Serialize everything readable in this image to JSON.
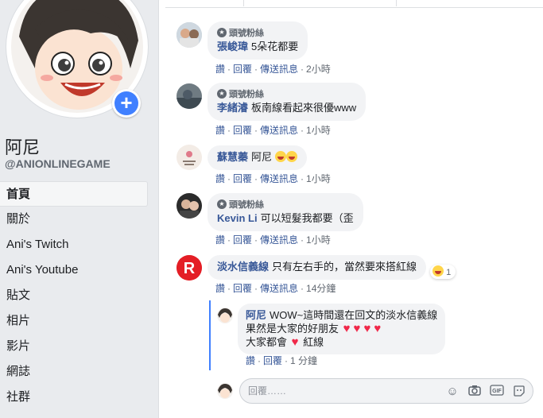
{
  "page": {
    "name": "阿尼",
    "handle": "@ANIONLINEGAME"
  },
  "nav": [
    {
      "label": "首頁"
    },
    {
      "label": "關於"
    },
    {
      "label": "Ani's Twitch"
    },
    {
      "label": "Ani's Youtube"
    },
    {
      "label": "貼文"
    },
    {
      "label": "相片"
    },
    {
      "label": "影片"
    },
    {
      "label": "網誌"
    },
    {
      "label": "社群"
    }
  ],
  "actions_labels": {
    "like": "讚",
    "reply": "回覆",
    "message": "傳送訊息"
  },
  "comments": [
    {
      "badge": "頭號粉絲",
      "author": "張峻瑋",
      "text": "5朵花都要",
      "time": "2小時"
    },
    {
      "badge": "頭號粉絲",
      "author": "李緒濬",
      "text": "板南線看起來很優www",
      "time": "1小時"
    },
    {
      "badge": "",
      "author": "蘇慧蓁",
      "text": "阿尼",
      "time": "1小時"
    },
    {
      "badge": "頭號粉絲",
      "author": "Kevin Li",
      "text": "可以短髮我都要（歪",
      "time": "1小時"
    },
    {
      "badge": "",
      "author": "淡水信義線",
      "text": "只有左右手的，當然要來搭紅線",
      "time": "14分鐘",
      "reaction_count": "1"
    }
  ],
  "reply": {
    "author": "阿尼",
    "line1": "WOW~這時間還在回文的淡水信義線",
    "line2": "果然是大家的好朋友",
    "line3a": "大家都會",
    "line3b": "紅線",
    "time": "1 分鐘"
  },
  "composer": {
    "placeholder": "回覆……"
  },
  "colors": {
    "link": "#385898",
    "accent": "#4080ff",
    "heart": "#f02849"
  },
  "icons": [
    "plus-icon",
    "star-badge-icon",
    "smile-icon",
    "camera-icon",
    "gif-icon",
    "sticker-icon"
  ]
}
